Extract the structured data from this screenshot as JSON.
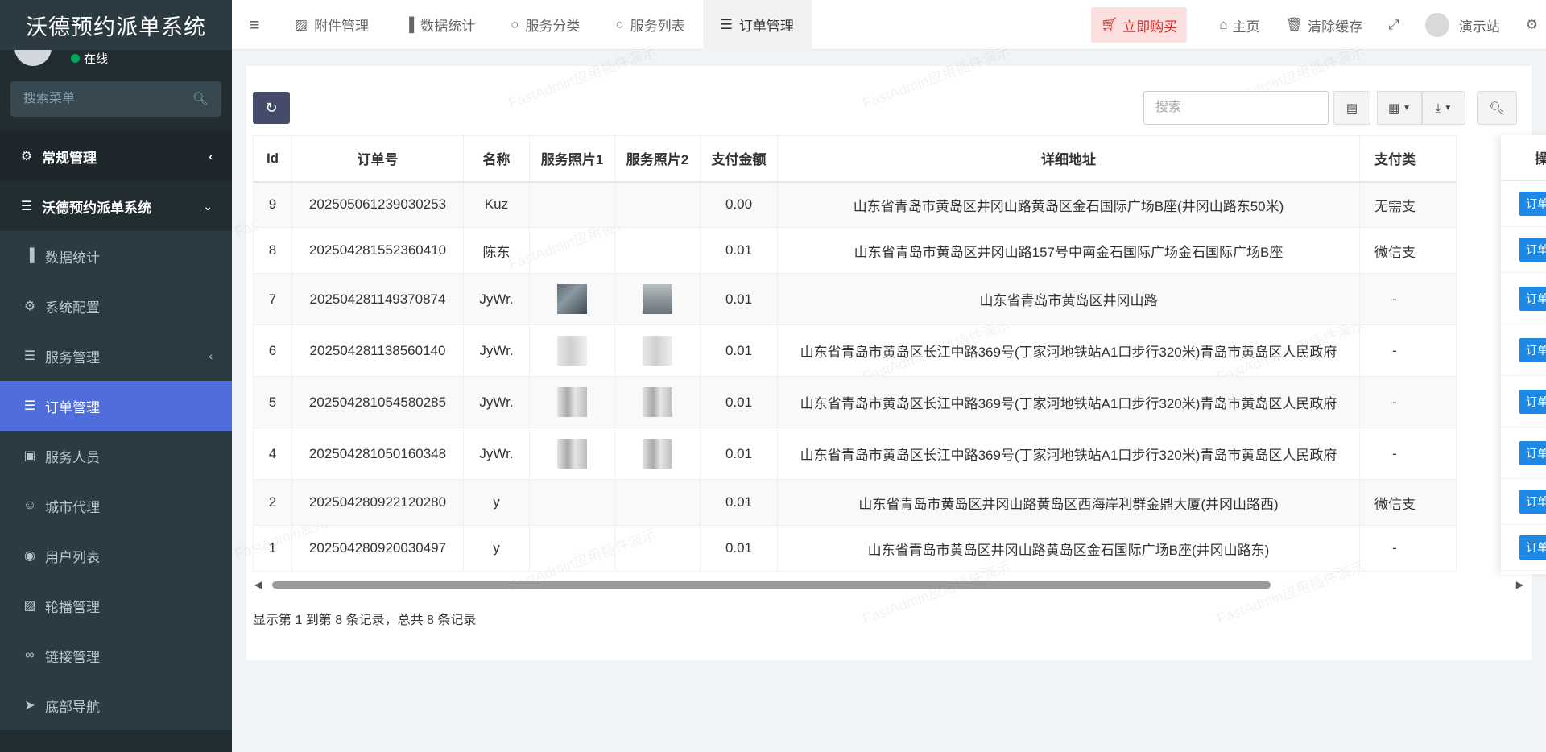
{
  "app": {
    "title": "沃德预约派单系统"
  },
  "user_panel": {
    "status": "在线"
  },
  "sidebar": {
    "search_placeholder": "搜索菜单",
    "items": [
      {
        "label": "常规管理",
        "icon": "cogs-icon"
      },
      {
        "label": "沃德预约派单系统",
        "icon": "list-icon"
      },
      {
        "label": "数据统计",
        "icon": "bar-chart-icon"
      },
      {
        "label": "系统配置",
        "icon": "gear-icon"
      },
      {
        "label": "服务管理",
        "icon": "server-icon"
      },
      {
        "label": "订单管理",
        "icon": "list-icon"
      },
      {
        "label": "服务人员",
        "icon": "id-card-icon"
      },
      {
        "label": "城市代理",
        "icon": "user-tie-icon"
      },
      {
        "label": "用户列表",
        "icon": "user-circle-icon"
      },
      {
        "label": "轮播管理",
        "icon": "image-icon"
      },
      {
        "label": "链接管理",
        "icon": "link-icon"
      },
      {
        "label": "底部导航",
        "icon": "paper-plane-icon"
      }
    ]
  },
  "navbar": {
    "tabs": [
      {
        "label": "附件管理",
        "icon": "image-icon"
      },
      {
        "label": "数据统计",
        "icon": "bar-chart-icon"
      },
      {
        "label": "服务分类",
        "icon": "circle-icon"
      },
      {
        "label": "服务列表",
        "icon": "circle-icon"
      },
      {
        "label": "订单管理",
        "icon": "list-icon"
      }
    ],
    "buy_label": "立即购买",
    "home_label": "主页",
    "clear_cache_label": "清除缓存",
    "user_name": "演示站"
  },
  "toolbar": {
    "search_placeholder": "搜索"
  },
  "table": {
    "columns": [
      "Id",
      "订单号",
      "名称",
      "服务照片1",
      "服务照片2",
      "支付金额",
      "详细地址",
      "支付类"
    ],
    "ops_header": "操作",
    "detail_label": "订单详情",
    "rows": [
      {
        "id": "9",
        "order_no": "202505061239030253",
        "name": "Kuz",
        "photo1": "",
        "photo2": "",
        "amount": "0.00",
        "address": "山东省青岛市黄岛区井冈山路黄岛区金石国际广场B座(井冈山路东50米)",
        "pay_type": "无需支"
      },
      {
        "id": "8",
        "order_no": "202504281552360410",
        "name": "陈东",
        "photo1": "",
        "photo2": "",
        "amount": "0.01",
        "address": "山东省青岛市黄岛区井冈山路157号中南金石国际广场金石国际广场B座",
        "pay_type": "微信支"
      },
      {
        "id": "7",
        "order_no": "202504281149370874",
        "name": "JyWr.",
        "photo1": "t-dark",
        "photo2": "t-city",
        "amount": "0.01",
        "address": "山东省青岛市黄岛区井冈山路",
        "pay_type": "-"
      },
      {
        "id": "6",
        "order_no": "202504281138560140",
        "name": "JyWr.",
        "photo1": "t-fog",
        "photo2": "t-fog",
        "amount": "0.01",
        "address": "山东省青岛市黄岛区长江中路369号(丁家河地铁站A1口步行320米)青岛市黄岛区人民政府",
        "pay_type": "-"
      },
      {
        "id": "5",
        "order_no": "202504281054580285",
        "name": "JyWr.",
        "photo1": "t-fog2",
        "photo2": "t-fog2",
        "amount": "0.01",
        "address": "山东省青岛市黄岛区长江中路369号(丁家河地铁站A1口步行320米)青岛市黄岛区人民政府",
        "pay_type": "-"
      },
      {
        "id": "4",
        "order_no": "202504281050160348",
        "name": "JyWr.",
        "photo1": "t-fog2",
        "photo2": "t-fog2",
        "amount": "0.01",
        "address": "山东省青岛市黄岛区长江中路369号(丁家河地铁站A1口步行320米)青岛市黄岛区人民政府",
        "pay_type": "-"
      },
      {
        "id": "2",
        "order_no": "202504280922120280",
        "name": "y",
        "photo1": "",
        "photo2": "",
        "amount": "0.01",
        "address": "山东省青岛市黄岛区井冈山路黄岛区西海岸利群金鼎大厦(井冈山路西)",
        "pay_type": "微信支"
      },
      {
        "id": "1",
        "order_no": "202504280920030497",
        "name": "y",
        "photo1": "",
        "photo2": "",
        "amount": "0.01",
        "address": "山东省青岛市黄岛区井冈山路黄岛区金石国际广场B座(井冈山路东)",
        "pay_type": "-"
      }
    ]
  },
  "pagination": {
    "info": "显示第 1 到第 8 条记录，总共 8 条记录"
  },
  "watermark_text": "FastAdmin应用插件演示",
  "colors": {
    "sidebar_bg": "#222d32",
    "active_menu": "#4f6edc",
    "detail_btn": "#1e88e5",
    "buy_bg": "#fcdfdf",
    "buy_text": "#e02d2d"
  }
}
